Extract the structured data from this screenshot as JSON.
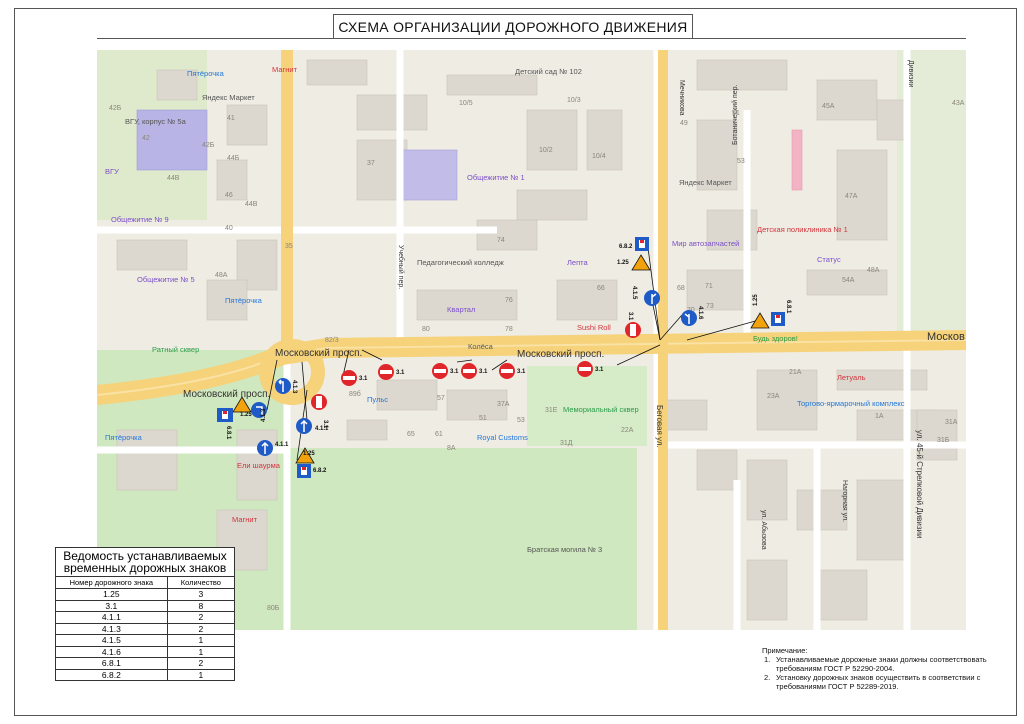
{
  "title": "СХЕМА  ОРГАНИЗАЦИИ ДОРОЖНОГО ДВИЖЕНИЯ",
  "colors": {
    "road_main": "#f6d27a",
    "road_minor": "#ffffff",
    "park": "#cfe8bf",
    "building": "#dedbd2",
    "background": "#efece3",
    "prohibit_red": "#e0262b",
    "mandatory_blue": "#1f5bc7",
    "warning_orange": "#f2a20c",
    "poi_purple": "#7b4ec9",
    "poi_green": "#2a9b48",
    "poi_blue": "#2377d9"
  },
  "map": {
    "streets": {
      "moskovsky_1": "Московский просп.",
      "moskovsky_2": "Московский просп.",
      "moskovsky_3": "Московский просп.",
      "moskovsky_right": "Москов",
      "uchebny": "Учебный пер.",
      "begovaya": "Беговая ул.",
      "batanichesky": "Ботанический пер.",
      "mechnikova": "Мечникова",
      "nagornaya": "Нагорная ул.",
      "abyzova": "ул. Абызова",
      "strelkovoy": "ул. 45-й Стрелковой Дивизии",
      "divizii_top": "Дивизии"
    },
    "pois": {
      "detsad": "Детский сад № 102",
      "vgu": "ВГУ, корпус № 5а",
      "vgu_short": "ВГУ",
      "obsh1": "Общежитие № 1",
      "obsh9": "Общежитие № 9",
      "obsh5": "Общежитие № 5",
      "pedcollege": "Педагогический колледж",
      "ratny": "Ратный сквер",
      "memorial": "Мемориальный сквер",
      "bratskaya": "Братская могила № 3",
      "torg": "Торгово-ярмарочный комплекс",
      "poliklinika": "Детская поликлиника № 1",
      "status": "Статус",
      "budzdorov": "Будь здоров!",
      "pyaterochka1": "Пятёрочка",
      "pyaterochka2": "Пятёрочка",
      "pyaterochka3": "Пятёрочка",
      "magnit1": "Магнит",
      "magnit2": "Магнит",
      "yandex_market1": "Яндекс Маркет",
      "yandex_market2": "Яндекс Маркет",
      "royal": "Royal Customs",
      "koleso": "Колёса",
      "kvartal": "Квартал",
      "letoile": "Летуаль",
      "mir_avto": "Мир автозапчастей",
      "lepta": "Лепта",
      "sushi": "Sushi Roll",
      "pulse": "Пульс",
      "shaurma": "Ели шаурма"
    },
    "house_numbers": [
      "42Б",
      "41",
      "44Б",
      "42",
      "42Б",
      "44В",
      "46",
      "48А",
      "40",
      "37",
      "35",
      "10/5",
      "10/3",
      "10/2",
      "10/4",
      "49",
      "51",
      "53",
      "47А",
      "45А",
      "43А",
      "74",
      "76",
      "78",
      "80",
      "82/3",
      "66",
      "68",
      "70",
      "71",
      "73",
      "54А",
      "48А",
      "21А",
      "23А",
      "1А",
      "31А",
      "31Б",
      "37А",
      "31Е",
      "51",
      "53",
      "57",
      "65",
      "61",
      "89б",
      "22А",
      "31Д",
      "44В",
      "8А",
      "80Б"
    ],
    "signs": {
      "s_3_1": "3.1",
      "s_1_25": "1.25",
      "s_4_1_1": "4.1.1",
      "s_4_1_3": "4.1.3",
      "s_4_1_5": "4.1.5",
      "s_4_1_6": "4.1.6",
      "s_6_8_1": "6.8.1",
      "s_6_8_2": "6.8.2"
    }
  },
  "table": {
    "caption": "Ведомость устанавливаемых временных дорожных знаков",
    "col1_header": "Номер дорожного знака",
    "col2_header": "Количество",
    "rows": [
      {
        "sign": "1.25",
        "count": "3"
      },
      {
        "sign": "3.1",
        "count": "8"
      },
      {
        "sign": "4.1.1",
        "count": "2"
      },
      {
        "sign": "4.1.3",
        "count": "2"
      },
      {
        "sign": "4.1.5",
        "count": "1"
      },
      {
        "sign": "4.1.6",
        "count": "1"
      },
      {
        "sign": "6.8.1",
        "count": "2"
      },
      {
        "sign": "6.8.2",
        "count": "1"
      }
    ]
  },
  "notes": {
    "heading": "Примечание:",
    "items": [
      "Устанавливаемые дорожные знаки должны соответствовать требованиям ГОСТ Р 52290-2004.",
      "Установку дорожных знаков осуществить в соответствии с требованиями ГОСТ Р 52289-2019."
    ],
    "num1": "1.",
    "num2": "2."
  }
}
